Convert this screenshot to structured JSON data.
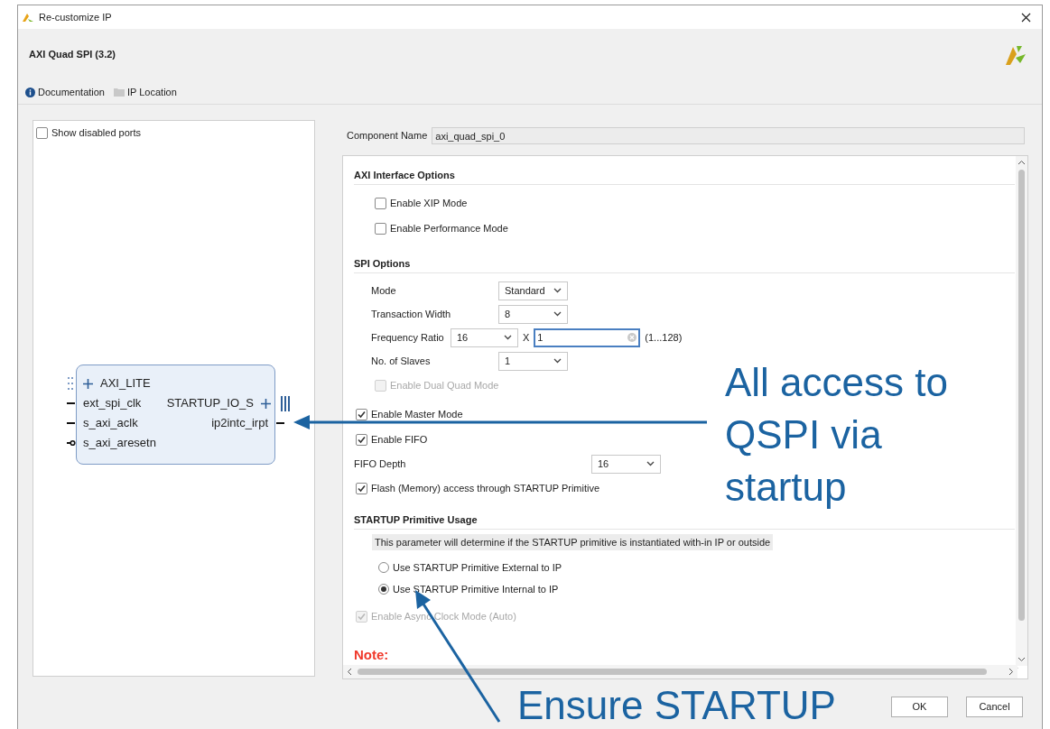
{
  "window": {
    "title": "Re-customize IP"
  },
  "header": {
    "title": "AXI Quad SPI (3.2)"
  },
  "links": [
    {
      "label": "Documentation",
      "kind": "info"
    },
    {
      "label": "IP Location",
      "kind": "folder"
    }
  ],
  "symbol": {
    "show_disabled_ports": {
      "label": "Show disabled ports",
      "checked": false
    },
    "left_ports": [
      {
        "label": "AXI_LITE",
        "kind": "bus"
      },
      {
        "label": "ext_spi_clk",
        "kind": "wire"
      },
      {
        "label": "s_axi_aclk",
        "kind": "wire"
      },
      {
        "label": "s_axi_aresetn",
        "kind": "inverted"
      }
    ],
    "right_ports": [
      {
        "label": "STARTUP_IO_S",
        "kind": "bus"
      },
      {
        "label": "ip2intc_irpt",
        "kind": "wire"
      }
    ]
  },
  "component_name": {
    "label": "Component Name",
    "value": "axi_quad_spi_0"
  },
  "sections": [
    {
      "kind": "standard",
      "title": "AXI Interface Options",
      "items": [
        {
          "kind": "group",
          "children": [
            {
              "kind": "checkbox",
              "label": "Enable XIP Mode",
              "checked": false,
              "disabled": false
            },
            {
              "kind": "checkbox",
              "label": "Enable Performance Mode",
              "checked": false,
              "disabled": false
            }
          ]
        }
      ]
    },
    {
      "kind": "standard",
      "title": "SPI Options",
      "items": [
        {
          "kind": "group",
          "children": [
            {
              "kind": "select",
              "label": "Mode",
              "value": "Standard"
            },
            {
              "kind": "select",
              "label": "Transaction Width",
              "value": "8"
            },
            {
              "kind": "ratio",
              "label": "Frequency Ratio",
              "value": "16",
              "multiplier": "X",
              "input": "1",
              "range": "(1...128)"
            },
            {
              "kind": "select",
              "label": "No. of Slaves",
              "value": "1"
            },
            {
              "kind": "checkbox",
              "label": "Enable Dual Quad Mode",
              "checked": false,
              "disabled": true
            }
          ]
        },
        {
          "kind": "checkbox",
          "label": "Enable Master Mode",
          "checked": true,
          "disabled": false
        },
        {
          "kind": "checkbox",
          "label": "Enable FIFO",
          "checked": true,
          "disabled": false
        },
        {
          "kind": "select",
          "label": "FIFO Depth",
          "value": "16"
        },
        {
          "kind": "checkbox",
          "label": "Flash (Memory) access through STARTUP Primitive",
          "checked": true,
          "disabled": false
        }
      ]
    },
    {
      "kind": "standard",
      "title": "STARTUP Primitive Usage",
      "items": [
        {
          "kind": "description",
          "text": "This parameter will determine if the STARTUP primitive is instantiated with-in IP or outside"
        },
        {
          "kind": "group",
          "children": [
            {
              "kind": "radio",
              "label": "Use STARTUP Primitive External to IP",
              "selected": false
            },
            {
              "kind": "radio",
              "label": "Use STARTUP Primitive Internal to IP",
              "selected": true
            }
          ]
        },
        {
          "kind": "checkbox",
          "label": "Enable Async Clock Mode (Auto)",
          "checked": true,
          "disabled": true
        }
      ]
    },
    {
      "kind": "note",
      "title": "Note:"
    }
  ],
  "buttons": [
    {
      "label": "OK"
    },
    {
      "label": "Cancel"
    }
  ],
  "annotations": [
    {
      "kind": "callout",
      "text": "All access to QSPI via startup"
    },
    {
      "kind": "caption",
      "text": "Ensure STARTUP"
    }
  ]
}
